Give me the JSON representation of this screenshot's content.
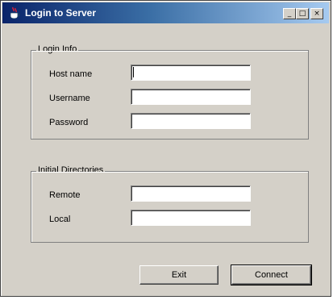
{
  "window": {
    "title": "Login to Server",
    "controls": {
      "minimize": "_",
      "maximize": "□",
      "close": "×"
    }
  },
  "login_info": {
    "legend": "Login Info",
    "fields": [
      {
        "label": "Host name",
        "value": ""
      },
      {
        "label": "Username",
        "value": ""
      },
      {
        "label": "Password",
        "value": ""
      }
    ]
  },
  "directories": {
    "legend": "Initial Directories",
    "fields": [
      {
        "label": "Remote",
        "value": ""
      },
      {
        "label": "Local",
        "value": ""
      }
    ]
  },
  "buttons": {
    "exit": "Exit",
    "connect": "Connect"
  },
  "colors": {
    "face": "#d4d0c8",
    "title_start": "#0a246a",
    "title_end": "#a6caf0"
  },
  "icons": {
    "app": "java-cup-icon"
  }
}
